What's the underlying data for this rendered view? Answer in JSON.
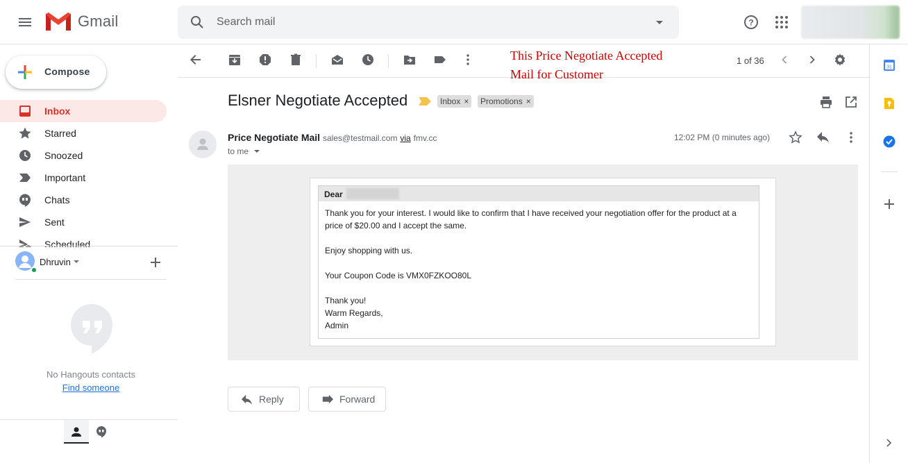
{
  "header": {
    "app_name": "Gmail",
    "search_placeholder": "Search mail"
  },
  "compose": {
    "label": "Compose"
  },
  "nav": {
    "items": [
      {
        "label": "Inbox",
        "icon": "inbox-icon",
        "active": true
      },
      {
        "label": "Starred",
        "icon": "star-icon"
      },
      {
        "label": "Snoozed",
        "icon": "clock-icon"
      },
      {
        "label": "Important",
        "icon": "important-icon"
      },
      {
        "label": "Chats",
        "icon": "chat-icon"
      },
      {
        "label": "Sent",
        "icon": "send-icon"
      },
      {
        "label": "Scheduled",
        "icon": "scheduled-icon"
      }
    ]
  },
  "hangouts": {
    "user_name": "Dhruvin",
    "empty_text": "No Hangouts contacts",
    "find_link": "Find someone"
  },
  "toolbar": {
    "annotation_line1": "This Price Negotiate Accepted",
    "annotation_line2": "Mail for Customer",
    "pager": "1 of 36"
  },
  "message": {
    "subject": "Elsner Negotiate Accepted",
    "labels": [
      "Inbox",
      "Promotions"
    ],
    "sender_name": "Price Negotiate Mail",
    "sender_email": "sales@testmail.com",
    "via_text": "via",
    "via_domain": "fmv.cc",
    "to_text": "to me",
    "timestamp": "12:02 PM (0 minutes ago)",
    "body": {
      "greeting": "Dear",
      "paragraph1": "Thank you for your interest. I would like to confirm that I have received your negotiation offer for the product at a price of $20.00 and I accept the same.",
      "paragraph2": "Enjoy shopping with us.",
      "paragraph3": "Your Coupon Code is VMX0FZKOO80L",
      "signoff1": "Thank you!",
      "signoff2": "Warm Regards,",
      "signoff3": "Admin"
    }
  },
  "actions": {
    "reply_label": "Reply",
    "forward_label": "Forward"
  },
  "colors": {
    "accent_red": "#d93025",
    "active_bg": "#fce8e6",
    "annotation_red": "#cc0000",
    "link_blue": "#1a73e8"
  }
}
